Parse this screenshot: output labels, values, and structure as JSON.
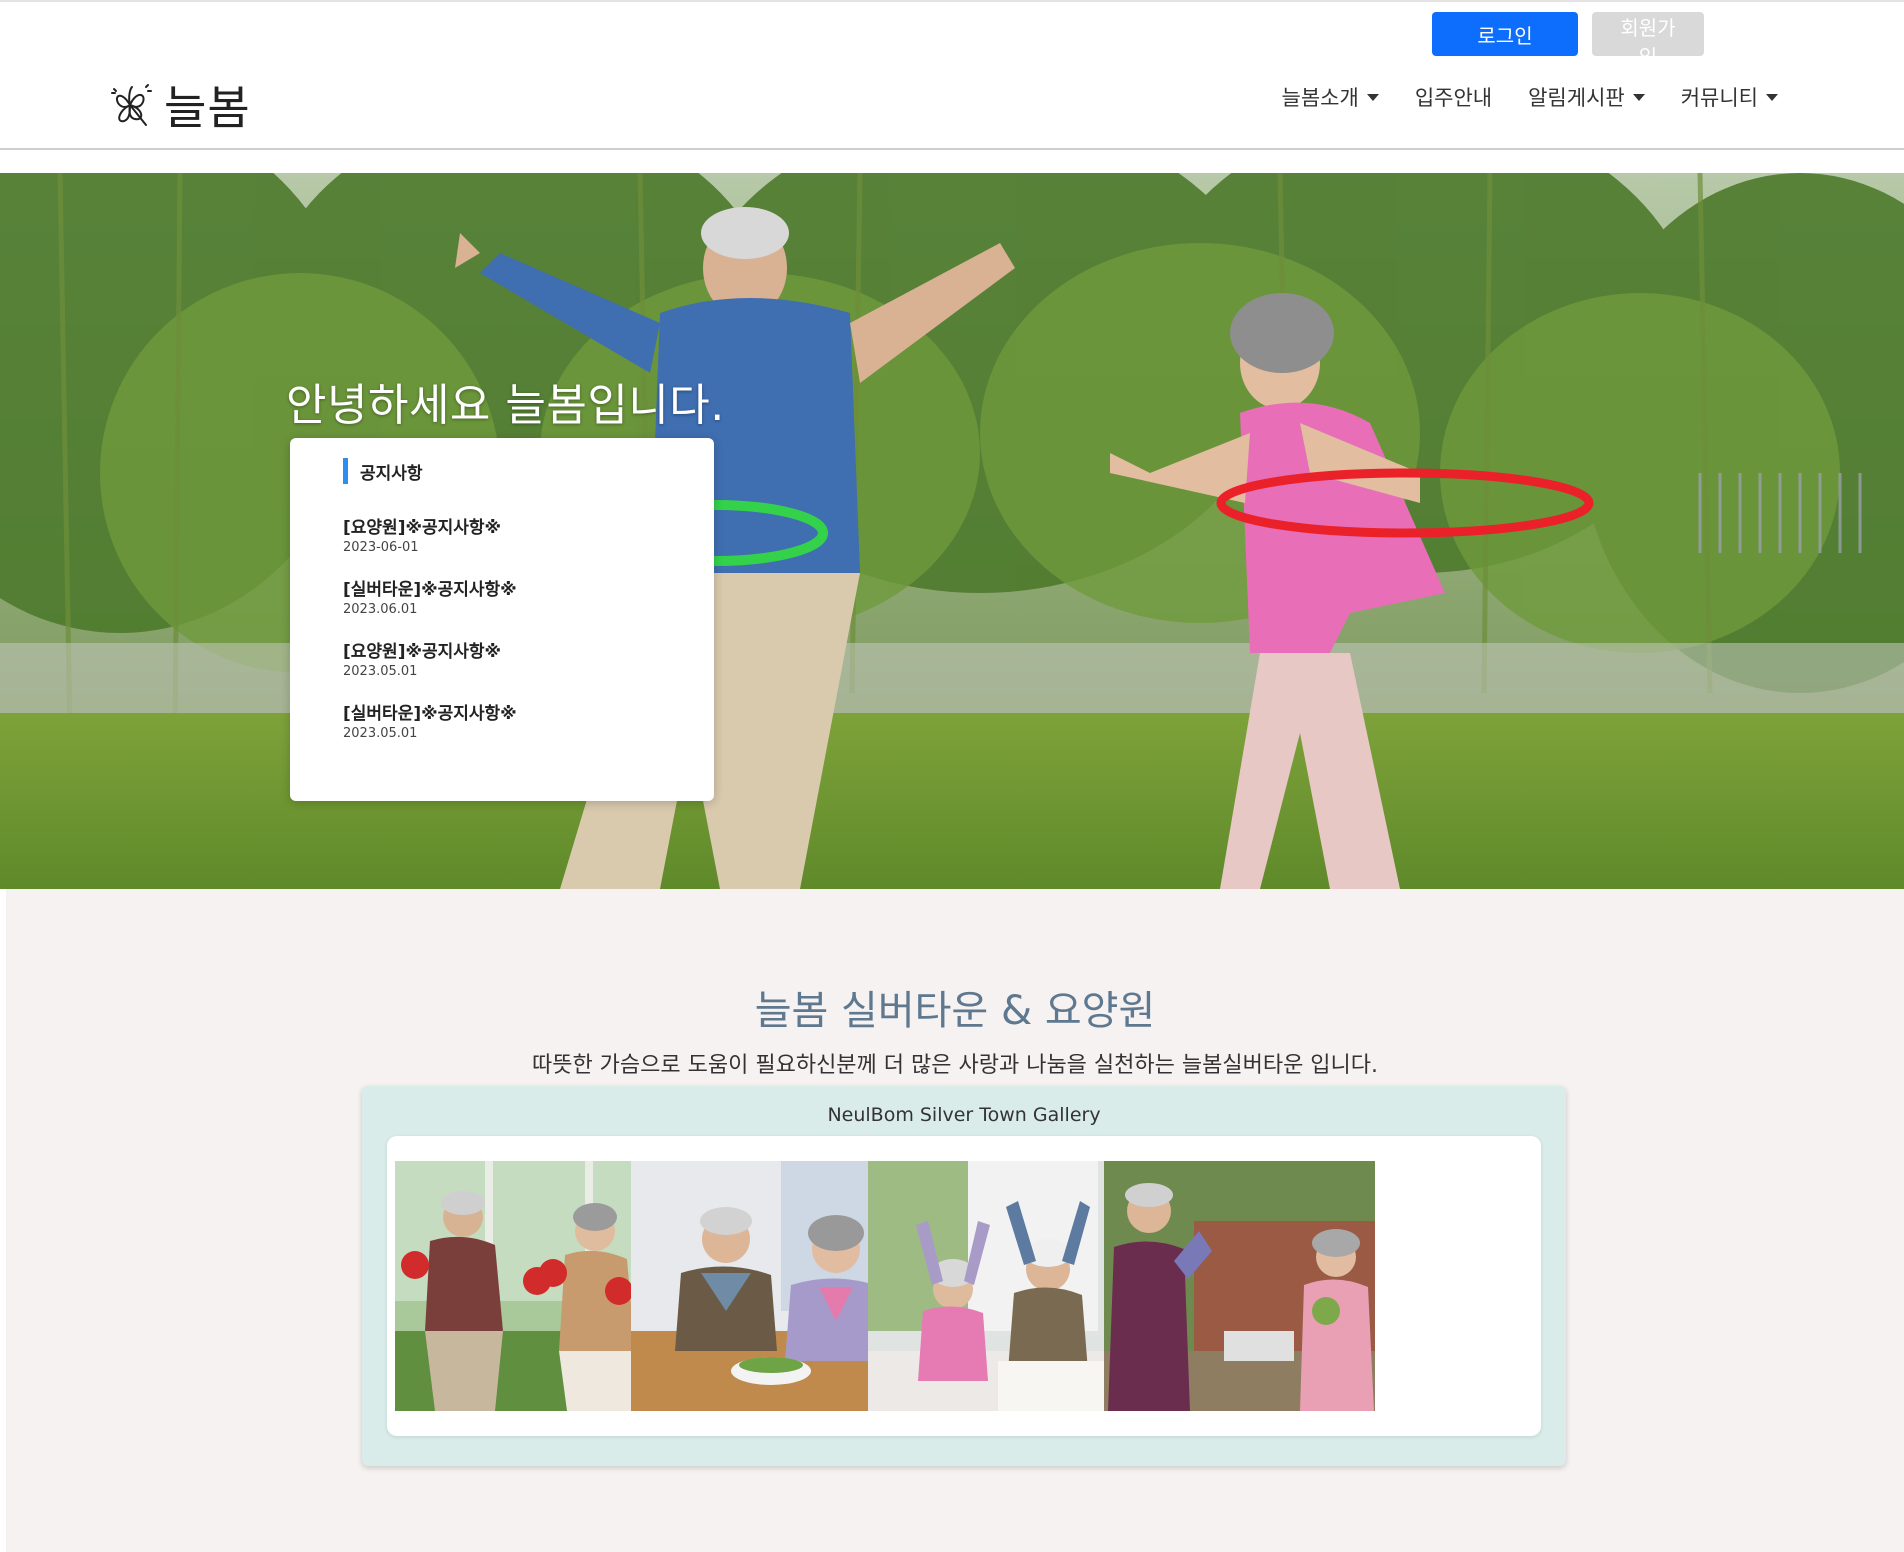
{
  "header": {
    "logo_text": "늘봄",
    "login_label": "로그인",
    "join_label": "회원가입",
    "nav": [
      {
        "label": "늘봄소개",
        "dropdown": true
      },
      {
        "label": "입주안내",
        "dropdown": false
      },
      {
        "label": "알림게시판",
        "dropdown": true
      },
      {
        "label": "커뮤니티",
        "dropdown": true
      }
    ]
  },
  "hero": {
    "title": "안녕하세요 늘봄입니다.",
    "notice": {
      "label": "공지사항",
      "items": [
        {
          "title": "[요양원]※공지사항※",
          "date": "2023-06-01"
        },
        {
          "title": "[실버타운]※공지사항※",
          "date": "2023.06.01"
        },
        {
          "title": "[요양원]※공지사항※",
          "date": "2023.05.01"
        },
        {
          "title": "[실버타운]※공지사항※",
          "date": "2023.05.01"
        }
      ]
    }
  },
  "intro": {
    "title": "늘봄 실버타운 & 요양원",
    "subtitle": "따뜻한 가슴으로 도움이 필요하신분께 더 많은 사랑과 나눔을 실천하는 늘봄실버타운 입니다."
  },
  "gallery": {
    "title": "NeulBom Silver Town Gallery",
    "photos": [
      "gallery-photo-boxing",
      "gallery-photo-salad",
      "gallery-photo-stretching",
      "gallery-photo-gardening"
    ]
  },
  "colors": {
    "primary": "#0d6efd",
    "join_button": "#d9d9d9",
    "intro_title": "#5e7890",
    "gallery_bg": "#d9ecea",
    "intro_bg": "#f6f2f1",
    "notice_accent": "#2a8ff0"
  }
}
